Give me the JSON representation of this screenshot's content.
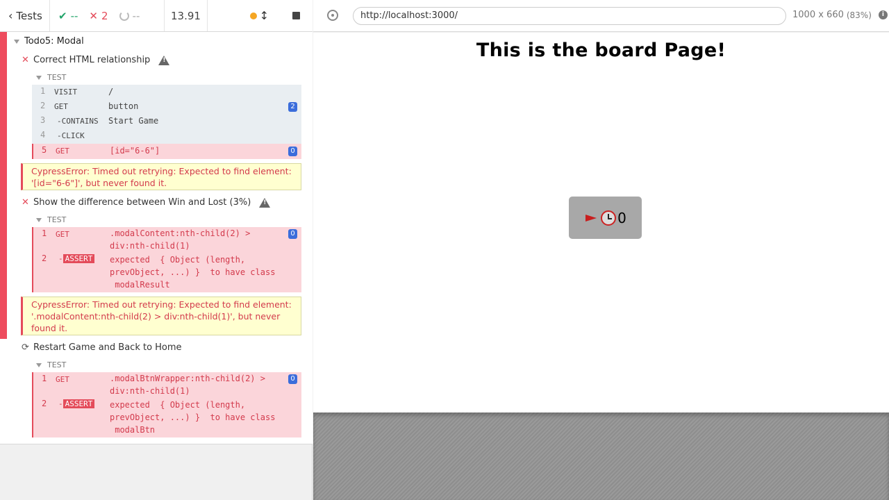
{
  "header": {
    "tests_label": "Tests",
    "passed": "--",
    "failed": "2",
    "pending": "--",
    "duration": "13.91"
  },
  "suite": {
    "title": "Todo5: Modal",
    "test_label": "TEST",
    "tests": [
      {
        "title": "Correct HTML relationship",
        "state": "failed",
        "commands": [
          {
            "num": "1",
            "name": "VISIT",
            "msg": "/",
            "badge": "",
            "state": "ok"
          },
          {
            "num": "2",
            "name": "GET",
            "msg": "button",
            "badge": "2",
            "state": "ok"
          },
          {
            "num": "3",
            "name": "-CONTAINS",
            "msg": "Start Game",
            "badge": "",
            "state": "ok"
          },
          {
            "num": "4",
            "name": "-CLICK",
            "msg": "",
            "badge": "",
            "state": "ok"
          },
          {
            "num": "5",
            "name": "GET",
            "msg": "[id=\"6-6\"]",
            "badge": "0",
            "state": "err"
          }
        ],
        "error": "CypressError: Timed out retrying: Expected to find element: '[id=\"6-6\"]', but never found it."
      },
      {
        "title": "Show the difference between Win and Lost (3%)",
        "state": "failed",
        "commands": [
          {
            "num": "1",
            "name": "GET",
            "msg": ".modalContent:nth-child(2) >\ndiv:nth-child(1)",
            "badge": "0",
            "state": "err"
          },
          {
            "num": "2",
            "name": "ASSERT",
            "msg": "expected  { Object (length,\nprevObject, ...) }  to have class\n modalResult",
            "badge": "",
            "state": "err"
          }
        ],
        "error": "CypressError: Timed out retrying: Expected to find element: '.modalContent:nth-child(2) > div:nth-child(1)', but never found it."
      },
      {
        "title": "Restart Game and Back to Home",
        "state": "retrying",
        "commands": [
          {
            "num": "1",
            "name": "GET",
            "msg": ".modalBtnWrapper:nth-child(2) >\ndiv:nth-child(1)",
            "badge": "0",
            "state": "err"
          },
          {
            "num": "2",
            "name": "ASSERT",
            "msg": "expected  { Object (length,\nprevObject, ...) }  to have class\n modalBtn",
            "badge": "",
            "state": "err"
          }
        ]
      }
    ]
  },
  "aut": {
    "url": "http://localhost:3000/",
    "viewport": "1000 x 660",
    "scale": "(83%)",
    "page_title": "This is the board Page!",
    "counter": "0"
  },
  "colors": {
    "fail": "#e44b5a",
    "pass": "#22a46a",
    "badge": "#3b6ddb",
    "error_bg": "#ffffd0"
  }
}
